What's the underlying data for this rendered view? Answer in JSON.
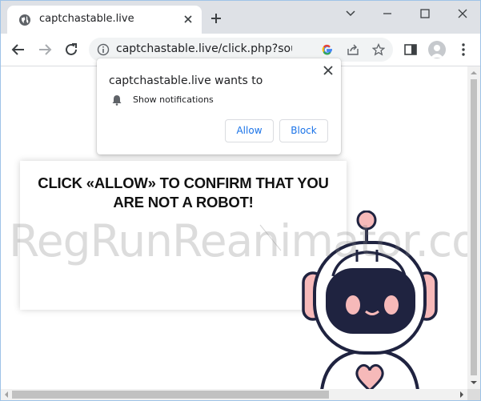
{
  "tab": {
    "title": "captchastable.live",
    "favicon": "globe-icon"
  },
  "toolbar": {
    "url": "captchastable.live/click.php?source"
  },
  "prompt": {
    "title": "captchastable.live wants to",
    "permission": "Show notifications",
    "allow_label": "Allow",
    "block_label": "Block"
  },
  "page": {
    "headline_line1": "CLICK «ALLOW» TO CONFIRM THAT YOU",
    "headline_line2": "ARE NOT A ROBOT!"
  },
  "watermark": "RegRunReanimator.com",
  "colors": {
    "tabstrip": "#dee1e6",
    "accent_blue": "#1a73e8",
    "robot_outline": "#1f2340",
    "robot_pink": "#f6b9b9"
  }
}
